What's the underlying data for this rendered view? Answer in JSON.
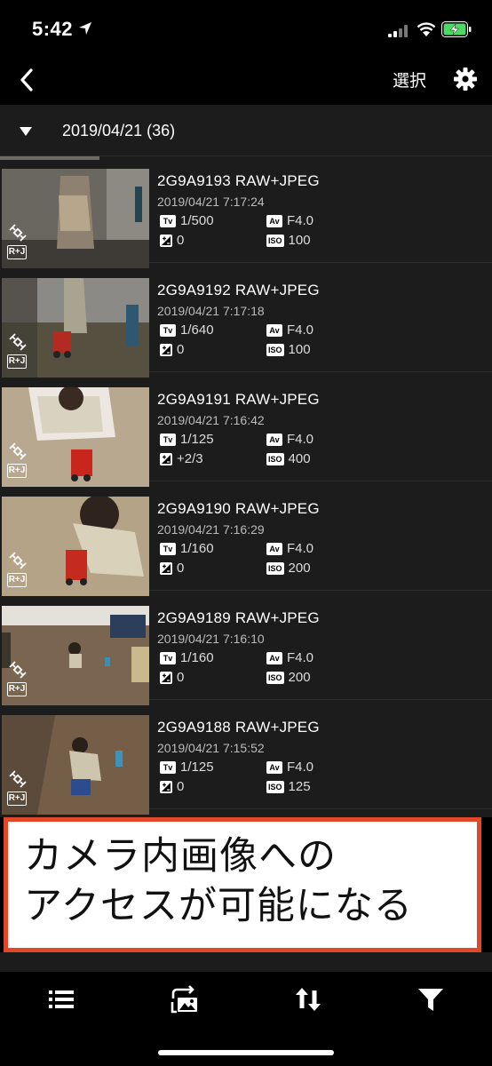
{
  "status_bar": {
    "time": "5:42"
  },
  "nav": {
    "select_label": "選択"
  },
  "group": {
    "label": "2019/04/21 (36)"
  },
  "photos": [
    {
      "name": "2G9A9193 RAW+JPEG",
      "datetime": "2019/04/21 7:17:24",
      "shutter": "1/500",
      "aperture": "F4.0",
      "exposure_comp": "0",
      "iso": "100",
      "format_badge": "R+J"
    },
    {
      "name": "2G9A9192 RAW+JPEG",
      "datetime": "2019/04/21 7:17:18",
      "shutter": "1/640",
      "aperture": "F4.0",
      "exposure_comp": "0",
      "iso": "100",
      "format_badge": "R+J"
    },
    {
      "name": "2G9A9191 RAW+JPEG",
      "datetime": "2019/04/21 7:16:42",
      "shutter": "1/125",
      "aperture": "F4.0",
      "exposure_comp": "+2/3",
      "iso": "400",
      "format_badge": "R+J"
    },
    {
      "name": "2G9A9190 RAW+JPEG",
      "datetime": "2019/04/21 7:16:29",
      "shutter": "1/160",
      "aperture": "F4.0",
      "exposure_comp": "0",
      "iso": "200",
      "format_badge": "R+J"
    },
    {
      "name": "2G9A9189 RAW+JPEG",
      "datetime": "2019/04/21 7:16:10",
      "shutter": "1/160",
      "aperture": "F4.0",
      "exposure_comp": "0",
      "iso": "200",
      "format_badge": "R+J"
    },
    {
      "name": "2G9A9188 RAW+JPEG",
      "datetime": "2019/04/21 7:15:52",
      "shutter": "1/125",
      "aperture": "F4.0",
      "exposure_comp": "0",
      "iso": "125",
      "format_badge": "R+J"
    }
  ],
  "exif_icons": {
    "tv": "Tv",
    "av": "Av",
    "iso": "ISO"
  },
  "callout": {
    "line1": "カメラ内画像への",
    "line2": "アクセスが可能になる"
  },
  "tabs": [
    {
      "icon": "list-icon"
    },
    {
      "icon": "image-transfer-icon"
    },
    {
      "icon": "sort-icon"
    },
    {
      "icon": "filter-icon"
    }
  ],
  "colors": {
    "callout_border": "#e2472a",
    "list_bg": "#1c1c1c",
    "battery_green": "#4cd964"
  }
}
